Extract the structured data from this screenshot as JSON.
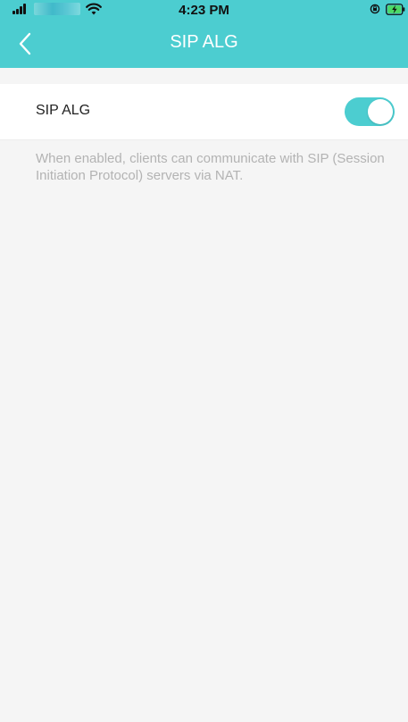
{
  "status_bar": {
    "time": "4:23 PM",
    "signal_icon": "signal-bars-icon",
    "wifi_icon": "wifi-icon",
    "rotation_lock_icon": "rotation-lock-icon",
    "battery_icon": "battery-charging-icon"
  },
  "nav": {
    "back_icon": "chevron-left-icon",
    "title": "SIP ALG"
  },
  "setting": {
    "label": "SIP ALG",
    "toggle_on": true,
    "description": "When enabled, clients can communicate with SIP (Session Initiation Protocol) servers via NAT."
  },
  "colors": {
    "accent": "#4ccdd0",
    "background": "#f5f5f5",
    "description_text": "#b3b3b3"
  }
}
